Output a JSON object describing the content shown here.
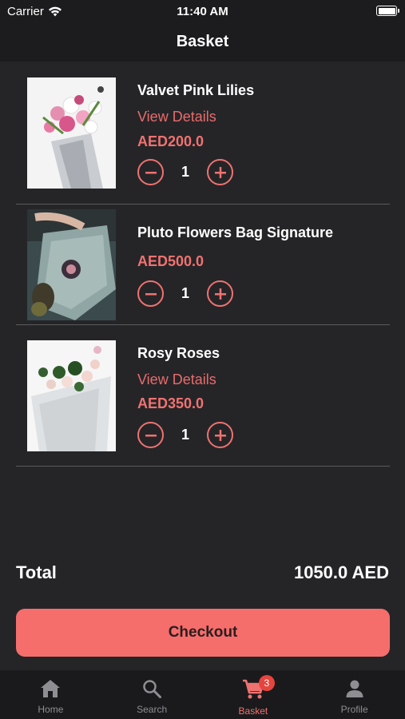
{
  "status_bar": {
    "carrier": "Carrier",
    "time": "11:40 AM"
  },
  "nav": {
    "title": "Basket"
  },
  "colors": {
    "accent": "#f07270",
    "background": "#252528",
    "checkout": "#f56e6c",
    "badge": "#e5453e"
  },
  "items": [
    {
      "name": "Valvet Pink Lilies",
      "link": "View Details",
      "price": "AED200.0",
      "quantity": "1"
    },
    {
      "name": "Pluto Flowers Bag Signature",
      "price": "AED500.0",
      "quantity": "1"
    },
    {
      "name": "Rosy Roses",
      "link": "View Details",
      "price": "AED350.0",
      "quantity": "1"
    }
  ],
  "total": {
    "label": "Total",
    "value": "1050.0 AED"
  },
  "checkout": {
    "label": "Checkout"
  },
  "tabs": [
    {
      "label": "Home",
      "icon": "home-icon"
    },
    {
      "label": "Search",
      "icon": "search-icon"
    },
    {
      "label": "Basket",
      "icon": "cart-icon",
      "badge": "3",
      "active": true
    },
    {
      "label": "Profile",
      "icon": "person-icon"
    }
  ]
}
